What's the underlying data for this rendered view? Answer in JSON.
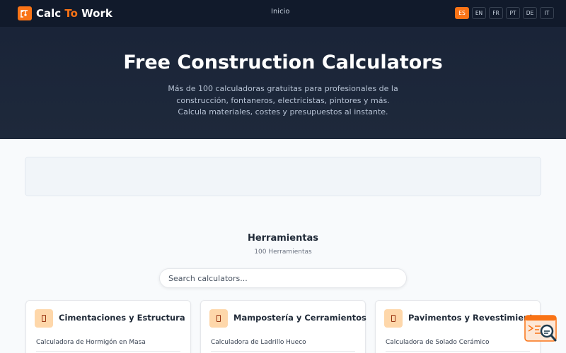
{
  "header": {
    "brand_part1": "Calc ",
    "brand_part2": "To",
    "brand_part3": " Work",
    "nav_home": "Inicio",
    "languages": [
      "ES",
      "EN",
      "FR",
      "PT",
      "DE",
      "IT"
    ],
    "active_language": "ES"
  },
  "hero": {
    "title": "Free Construction Calculators",
    "description": "Más de 100 calculadoras gratuitas para profesionales de la construcción, fontaneros, electricistas, pintores y más. Calcula materiales, costes y presupuestos al instante."
  },
  "tools": {
    "title": "Herramientas",
    "count": "100 Herramientas",
    "search_placeholder": "Search calculators..."
  },
  "categories": [
    {
      "title": "Cimentaciones y Estructura",
      "first_item": "Calculadora de Hormigón en Masa"
    },
    {
      "title": "Mampostería y Cerramientos",
      "first_item": "Calculadora de Ladrillo Hueco"
    },
    {
      "title": "Pavimentos y Revestimientos",
      "first_item": "Calculadora de Solado Cerámico"
    }
  ],
  "colors": {
    "accent": "#f97316",
    "header_bg": "#111a2b",
    "hero_bg": "#1e293b"
  },
  "icons": {
    "brand": "crane-icon",
    "category": "category-icon",
    "floating": "search-chat-icon"
  }
}
